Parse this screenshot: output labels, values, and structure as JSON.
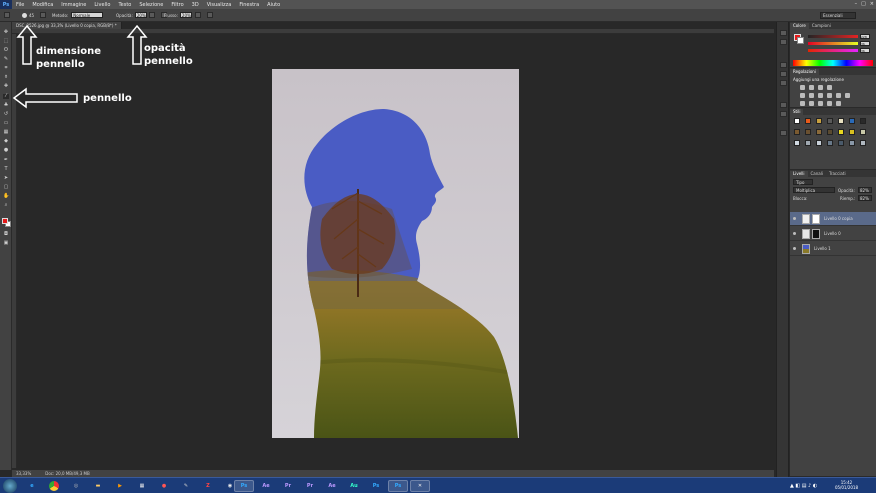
{
  "menu": {
    "logo": "Ps",
    "items": [
      "File",
      "Modifica",
      "Immagine",
      "Livello",
      "Testo",
      "Selezione",
      "Filtro",
      "3D",
      "Visualizza",
      "Finestra",
      "Aiuto"
    ],
    "window_controls": [
      "–",
      "□",
      "×"
    ]
  },
  "options": {
    "size_value": "45",
    "mode_label": "Metodo:",
    "mode_value": "Normale",
    "opacity_label": "Opacità:",
    "opacity_value": "20%",
    "flow_label": "Flusso:",
    "flow_value": "20%",
    "workspace": "Essenziali"
  },
  "document": {
    "tab_title": "DSC_8526.jpg @ 33,3% (Livello 0 copia, RGB/8*) *",
    "zoom": "33,33%",
    "doc_info": "Doc: 20,0 MB/49,3 MB"
  },
  "panels": {
    "color": {
      "tabs": [
        "Colore",
        "Campioni"
      ],
      "values": [
        "228",
        "36",
        "36"
      ]
    },
    "adjustments": {
      "tabs": [
        "Regolazioni"
      ],
      "title": "Aggiungi una regolazione"
    },
    "styles": {
      "tabs": [
        "Stili"
      ]
    },
    "layers": {
      "tabs": [
        "Livelli",
        "Canali",
        "Tracciati"
      ],
      "filter": "Tipo",
      "blend_mode": "Moltiplica",
      "opacity_label": "Opacità:",
      "opacity_value": "82%",
      "lock_label": "Blocca:",
      "fill_label": "Riemp.:",
      "fill_value": "82%",
      "items": [
        {
          "name": "Livello 0 copia",
          "selected": true
        },
        {
          "name": "Livello 0",
          "selected": false
        },
        {
          "name": "Livello 1",
          "selected": false
        }
      ]
    }
  },
  "taskbar": {
    "apps": [
      "Ps",
      "Ae",
      "Pr",
      "Pr",
      "Ae",
      "Au",
      "Ps",
      "Ps"
    ],
    "time": "15:42",
    "date": "05/01/2018"
  },
  "annotations": {
    "brush_size": "dimensione\npennello",
    "brush_opacity": "opacità\npennello",
    "brush_tool": "pennello"
  },
  "colors": {
    "foreground": "#e41b1b",
    "accent_blue": "#4a5cc4",
    "panel_bg": "#424242",
    "app_bg": "#282828"
  }
}
